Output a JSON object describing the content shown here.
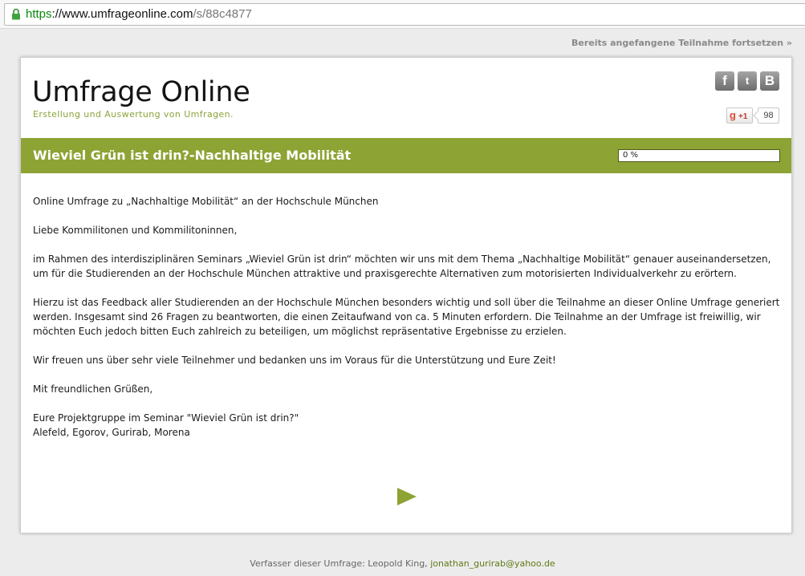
{
  "browser": {
    "url_scheme": "https",
    "url_host": "://www.umfrageonline.com",
    "url_path": "/s/88c4877"
  },
  "top_link": "Bereits angefangene Teilnahme fortsetzen »",
  "header": {
    "logo": "Umfrage Online",
    "tagline": "Erstellung und Auswertung von Umfragen.",
    "social": {
      "facebook": "f",
      "twitter": "t",
      "blogger": "B"
    },
    "gplus_g": "g",
    "gplus_label": "+1",
    "gplus_count": "98"
  },
  "survey": {
    "title": "Wieviel Grün ist drin?-Nachhaltige Mobilität",
    "progress_label": "0 %",
    "progress_value": 0,
    "intro": [
      "Online Umfrage zu „Nachhaltige Mobilität“ an der Hochschule München",
      "Liebe Kommilitonen und Kommilitoninnen,",
      "im Rahmen des interdisziplinären Seminars „Wieviel Grün ist drin“ möchten wir uns mit dem Thema „Nachhaltige Mobilität“ genauer auseinandersetzen, um für die Studierenden an der Hochschule München attraktive und praxisgerechte Alternativen zum motorisierten Individualverkehr zu erörtern.",
      "Hierzu ist das Feedback aller Studierenden an der Hochschule München besonders wichtig und soll über die Teilnahme an dieser Online Umfrage generiert werden. Insgesamt sind 26 Fragen zu beantworten, die einen Zeitaufwand von ca. 5 Minuten erfordern. Die Teilnahme an der Umfrage ist freiwillig, wir möchten Euch jedoch bitten Euch zahlreich zu beteiligen, um möglichst repräsentative Ergebnisse zu erzielen.",
      "Wir freuen uns über sehr viele Teilnehmer und bedanken uns im Voraus für die Unterstützung und Eure Zeit!",
      "Mit freundlichen Grüßen,"
    ],
    "signature_line1": "Eure Projektgruppe im Seminar \"Wieviel Grün ist drin?\"",
    "signature_line2": "Alefeld, Egorov, Gurirab, Morena"
  },
  "footer": {
    "text": "Verfasser dieser Umfrage: Leopold King,",
    "email": "jonathan_gurirab@yahoo.de"
  },
  "colors": {
    "accent": "#8da334",
    "tagline": "#8aa33a",
    "secure_scheme": "#0b8a0b"
  },
  "icons": {
    "lock": "lock-icon",
    "next": "play-arrow-icon"
  }
}
